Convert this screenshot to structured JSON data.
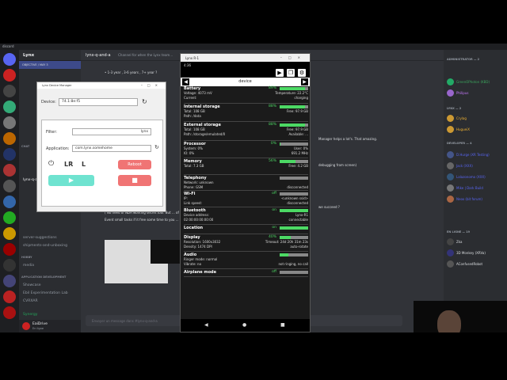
{
  "titlebar": "discord",
  "server_name": "Lynx",
  "channel_banner": "OBJECTIVE / MAY 3",
  "channel_header": {
    "name": "lynx-q-and-a",
    "desc": "Channel for when the Lynx team..."
  },
  "search_placeholder": "Rechercher",
  "channels": [
    {
      "label": "lynx-q-and-a"
    },
    {
      "label": "server-suggestions"
    },
    {
      "label": "shipments-and-unboxing"
    },
    {
      "label": "media"
    },
    {
      "label": "Showcase"
    },
    {
      "label": "Ebil Experimentation Lab"
    },
    {
      "label": "CVRXAR"
    }
  ],
  "categories": [
    "CHAT",
    "HOBBY",
    "APPLICATION DEVELOPMENT"
  ],
  "user": {
    "name": "EaiDrive",
    "status": "En ligne"
  },
  "voice": "Synergy",
  "messages": [
    "• 1-3 year , 3-6 years , 7+ year ?",
    "( No need of NDA working secret tool. But ... of how to create feature you need or solved bug/hard tasks ?",
    "Event small tasks if it free some time to you ... on what is important. )",
    "Manager helps a lot's. That amazing.",
    "debugging from screen)",
    "we succeed ?"
  ],
  "composer_placeholder": "Envoyer un message dans #lynx-q-and-a",
  "members": {
    "categories": [
      "ADMINISTRATOR — 2",
      "LYNX — 2",
      "DEVELOPER — 4",
      "EN LIGNE — 19"
    ],
    "list": [
      {
        "name": "GreenOPhoton (KBD)",
        "color": "#3ba55c"
      },
      {
        "name": "Philipus",
        "color": "#c879ff"
      },
      {
        "name": "Crylag",
        "color": "#f0b232"
      },
      {
        "name": "HugueiX",
        "color": "#f0b232"
      },
      {
        "name": "D.Hurge (XR Testing)",
        "color": "#5865f2"
      },
      {
        "name": "Jack (XXX)",
        "color": "#5865f2"
      },
      {
        "name": "Lalazonomo (XXX)",
        "color": "#5865f2"
      },
      {
        "name": "Mike | Dark Build",
        "color": "#5865f2"
      },
      {
        "name": "Neox (bit forum)",
        "color": "#5865f2"
      },
      {
        "name": "Zka",
        "color": "#dbdee1"
      },
      {
        "name": "3D Monkey (XRVa)",
        "color": "#dbdee1"
      },
      {
        "name": "AConfusedRobot",
        "color": "#dbdee1"
      }
    ]
  },
  "ldm": {
    "title": "Lynx Device Manager",
    "device_label": "Device:",
    "device_value": "74.1:8e:f5",
    "tabs": [
      "Device",
      "Application",
      "Logs"
    ],
    "filter_label": "Filter:",
    "filter_value": "lynx",
    "application_label": "Application:",
    "application_value": "com.lynx.somehome",
    "lr": "LR",
    "l": "L",
    "reboot": "Reboot",
    "play": "▶",
    "stop": "■"
  },
  "emulator": {
    "title": "Lynx R-1",
    "time": "4:36",
    "header": "device",
    "sections": [
      {
        "title": "Battery",
        "pct": "89%",
        "fill": 0.89,
        "rows": [
          [
            "Voltage: 4073 mV",
            "Temperature: 22.2°C"
          ],
          [
            "Current:",
            "charging"
          ]
        ]
      },
      {
        "title": "Internal storage",
        "pct": "88%",
        "fill": 0.88,
        "rows": [
          [
            "Total: 108 GB",
            "Free: 97.9 GB"
          ],
          [
            "Path: /data",
            ""
          ]
        ]
      },
      {
        "title": "External storage",
        "pct": "88%",
        "fill": 0.88,
        "rows": [
          [
            "Total: 108 GB",
            "Free: 97.9 GB"
          ],
          [
            "Path: /storage/emulated/0",
            "Available: ..."
          ]
        ]
      },
      {
        "title": "Processor",
        "pct": "0%",
        "fill": 0.02,
        "rows": [
          [
            "System: 0%",
            "User: 0%"
          ],
          [
            "IO: 0%",
            "691.2 MHz"
          ]
        ]
      },
      {
        "title": "Memory",
        "pct": "56%",
        "fill": 0.56,
        "rows": [
          [
            "Total: 7.3 GB",
            "Free: 4.2 GB"
          ]
        ]
      },
      {
        "title": "Telephony",
        "pct": "",
        "fill": 0,
        "rows": [
          [
            "Network: unknown",
            ""
          ],
          [
            "Phone: GSM",
            "disconnected"
          ]
        ]
      },
      {
        "title": "Wi-Fi",
        "pct": "off",
        "fill": 0,
        "rows": [
          [
            "IP:",
            "<unknown ssid>"
          ],
          [
            "Link speed:",
            "disconnected"
          ]
        ]
      },
      {
        "title": "Bluetooth",
        "pct": "on",
        "fill": 1,
        "rows": [
          [
            "Device address:",
            "Lynx-R1"
          ],
          [
            "02:00:00:00:00:00",
            "connectable"
          ]
        ]
      },
      {
        "title": "Location",
        "pct": "on",
        "fill": 1,
        "rows": []
      },
      {
        "title": "Display",
        "pct": "40%",
        "fill": 0.4,
        "rows": [
          [
            "Resolution: 1600x3032",
            "Timeout: 24d 20h 31m 23s"
          ],
          [
            "Density: 1474 DPI",
            "auto-rotate"
          ]
        ]
      },
      {
        "title": "Audio",
        "pct": "",
        "fill": 0.3,
        "rows": [
          [
            "Ringer mode: normal",
            ""
          ],
          [
            "Vibrate: no",
            "not ringing, no call"
          ]
        ]
      },
      {
        "title": "Airplane mode",
        "pct": "off",
        "fill": 0,
        "rows": []
      }
    ],
    "nav": [
      "◀",
      "●",
      "■"
    ]
  }
}
